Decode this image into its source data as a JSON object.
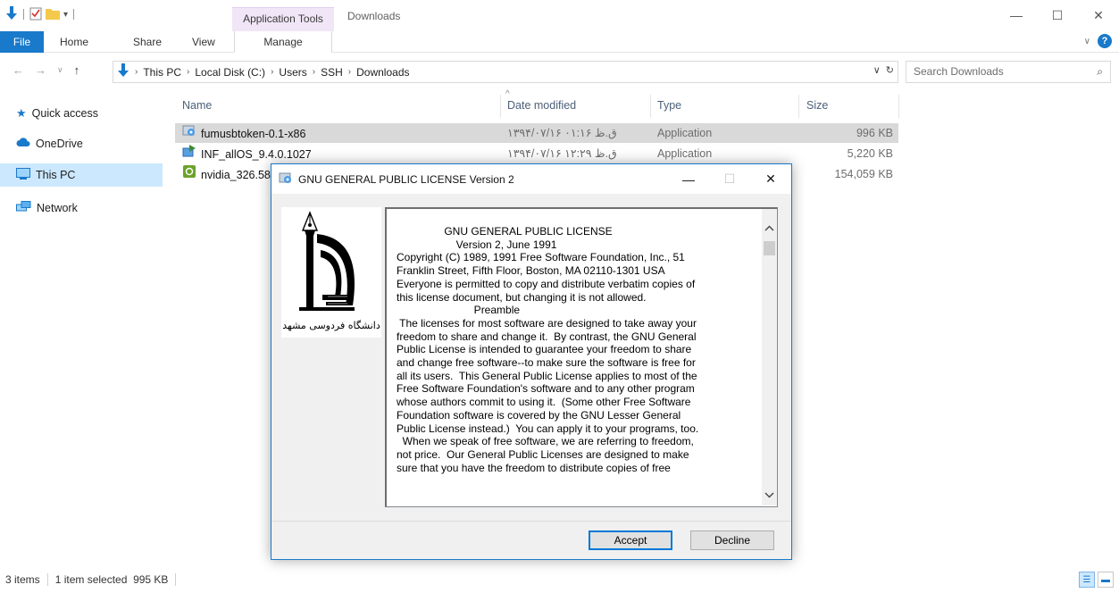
{
  "window": {
    "title": "Downloads",
    "context_tab": "Application Tools"
  },
  "ribbon": {
    "tabs": [
      "File",
      "Home",
      "Share",
      "View",
      "Manage"
    ]
  },
  "address": {
    "crumbs": [
      "This PC",
      "Local Disk (C:)",
      "Users",
      "SSH",
      "Downloads"
    ],
    "search_placeholder": "Search Downloads"
  },
  "navpane": {
    "items": [
      "Quick access",
      "OneDrive",
      "This PC",
      "Network"
    ]
  },
  "columns": {
    "name": "Name",
    "date": "Date modified",
    "type": "Type",
    "size": "Size"
  },
  "files": [
    {
      "name": "fumusbtoken-0.1-x86",
      "date": "۱۳۹۴/۰۷/۱۶ ق.ظ ۰۱:۱۶",
      "type": "Application",
      "size": "996 KB"
    },
    {
      "name": "INF_allOS_9.4.0.1027",
      "date": "۱۳۹۴/۰۷/۱۶ ق.ظ ۱۲:۲۹",
      "type": "Application",
      "size": "5,220 KB"
    },
    {
      "name": "nvidia_326.58",
      "date": "",
      "type": "",
      "size": "154,059 KB"
    }
  ],
  "status": {
    "count": "3 items",
    "selection": "1 item selected  995 KB"
  },
  "dialog": {
    "title": "GNU GENERAL PUBLIC LICENSE Version 2",
    "logo_text": "دانشگاه فردوسی مشهد",
    "license_lines": [
      "                GNU GENERAL PUBLIC LICENSE",
      "                    Version 2, June 1991",
      "Copyright (C) 1989, 1991 Free Software Foundation, Inc., 51",
      "Franklin Street, Fifth Floor, Boston, MA 02110-1301 USA",
      "Everyone is permitted to copy and distribute verbatim copies of",
      "this license document, but changing it is not allowed.",
      "                          Preamble",
      " The licenses for most software are designed to take away your",
      "freedom to share and change it.  By contrast, the GNU General",
      "Public License is intended to guarantee your freedom to share",
      "and change free software--to make sure the software is free for",
      "all its users.  This General Public License applies to most of the",
      "Free Software Foundation's software and to any other program",
      "whose authors commit to using it.  (Some other Free Software",
      "Foundation software is covered by the GNU Lesser General",
      "Public License instead.)  You can apply it to your programs, too.",
      "  When we speak of free software, we are referring to freedom,",
      "not price.  Our General Public Licenses are designed to make",
      "sure that you have the freedom to distribute copies of free"
    ],
    "accept_label": "Accept",
    "decline_label": "Decline"
  },
  "colors": {
    "accent": "#1979ca",
    "selection": "#cce8ff",
    "row_selected": "#d9d9d9"
  }
}
